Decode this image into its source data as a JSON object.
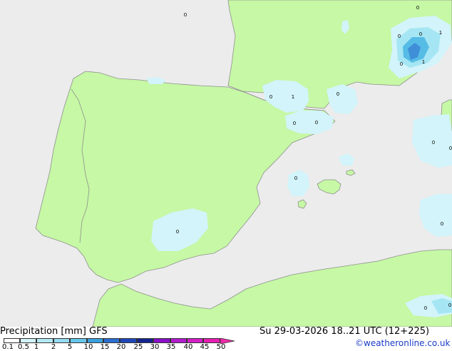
{
  "map": {
    "colors": {
      "sea": "#ececec",
      "land": "#c6f8a5",
      "border": "#8f8f8f",
      "precip_light": "#d2f4fa",
      "precip_mid": "#a6e6f4",
      "precip_strong": "#56bce6",
      "precip_core": "#3f8fd8"
    },
    "labels": [
      "0",
      "0",
      "1",
      "0",
      "0",
      "0",
      "0",
      "0",
      "1",
      "0",
      "1",
      "0",
      "0",
      "0",
      "0",
      "0",
      "0",
      "0",
      "0"
    ]
  },
  "footer": {
    "title": "Precipitation [mm] GFS",
    "datetime": "Su 29-03-2026 18..21 UTC (12+225)",
    "credit": "©weatheronline.co.uk"
  },
  "legend": {
    "ticks": [
      "0.1",
      "0.5",
      "1",
      "2",
      "5",
      "10",
      "15",
      "20",
      "25",
      "30",
      "35",
      "40",
      "45",
      "50"
    ],
    "colors": [
      "#ffffff",
      "#d2f4fa",
      "#b4eaf6",
      "#96dcf2",
      "#66c6ec",
      "#3aa0de",
      "#2a6ed0",
      "#1e46b8",
      "#14248e",
      "#8a0ec8",
      "#b41ad0",
      "#d41ec8",
      "#e81eb4",
      "#f02aa8"
    ]
  }
}
